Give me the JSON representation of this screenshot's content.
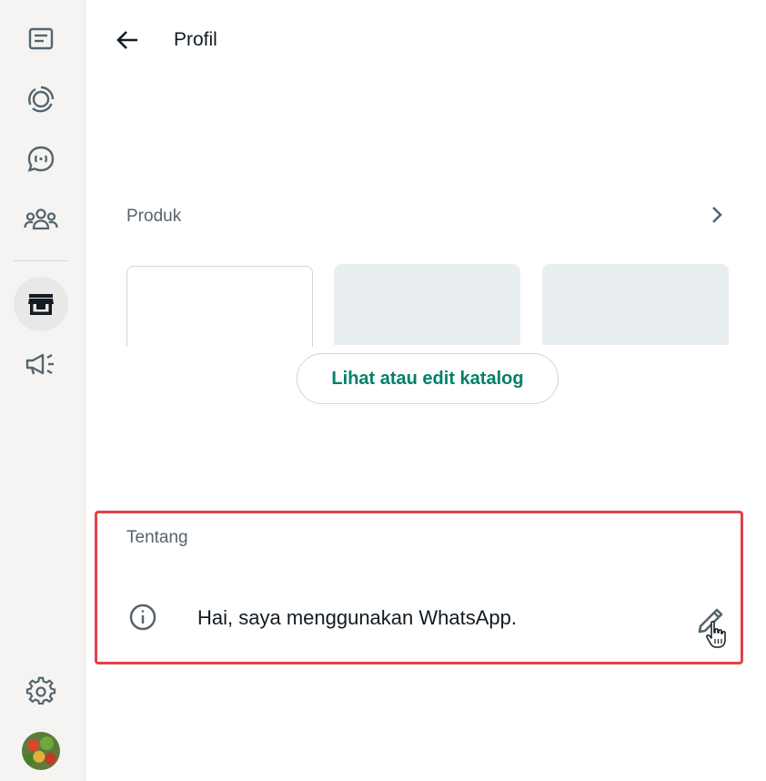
{
  "sidebar": {
    "items": [
      {
        "icon": "chats-icon"
      },
      {
        "icon": "status-icon"
      },
      {
        "icon": "channels-icon"
      },
      {
        "icon": "communities-icon"
      },
      {
        "icon": "business-tools-icon",
        "active": true
      },
      {
        "icon": "advertise-icon"
      }
    ],
    "settings_icon": "settings-icon",
    "avatar": "profile-avatar"
  },
  "header": {
    "title": "Profil"
  },
  "products": {
    "label": "Produk",
    "catalog_button": "Lihat atau edit katalog"
  },
  "about": {
    "label": "Tentang",
    "text": "Hai, saya menggunakan WhatsApp."
  },
  "colors": {
    "accent": "#008069",
    "highlight_border": "#e0424a"
  }
}
